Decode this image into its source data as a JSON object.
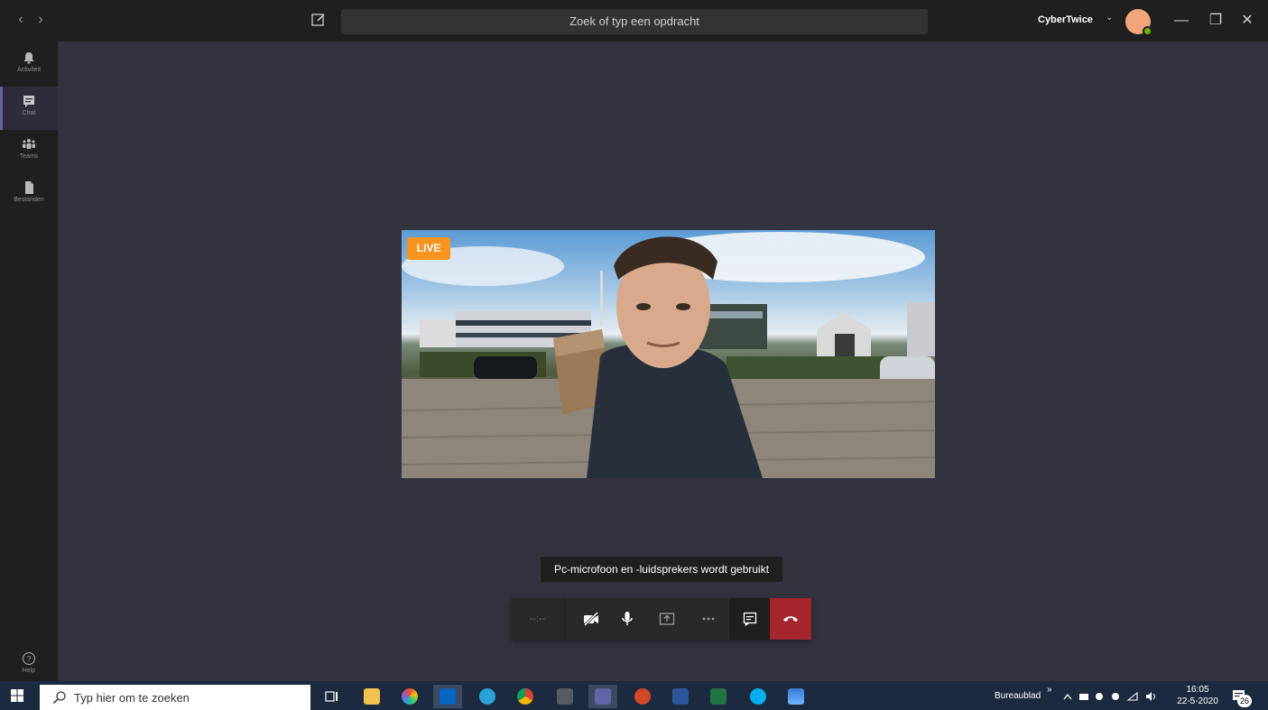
{
  "titlebar": {
    "back_glyph": "‹",
    "forward_glyph": "›",
    "search_placeholder": "Zoek of typ een opdracht",
    "user_name": "CyberTwice",
    "user_chevron": "⌄",
    "minimize_glyph": "—",
    "maximize_glyph": "❐",
    "close_glyph": "✕"
  },
  "rail": {
    "items": [
      {
        "label": "Activiteit",
        "icon": "bell-icon"
      },
      {
        "label": "Chat",
        "icon": "chat-icon",
        "active": true
      },
      {
        "label": "Teams",
        "icon": "teams-icon"
      },
      {
        "label": "Bestanden",
        "icon": "files-icon"
      }
    ],
    "help_label": "Help"
  },
  "call": {
    "live_label": "LIVE",
    "tooltip": "Pc-microfoon en -luidsprekers wordt gebruikt",
    "timer": "--:--"
  },
  "taskbar": {
    "search_placeholder": "Typ hier om te zoeken",
    "tray_label": "Bureaublad",
    "tray_chevron": "»",
    "time": "16:05",
    "date": "22-5-2020",
    "notification_count": "26"
  },
  "colors": {
    "accent": "#6264a7",
    "hangup": "#a4262c",
    "live": "#f7941d",
    "status_available": "#6bb700"
  }
}
